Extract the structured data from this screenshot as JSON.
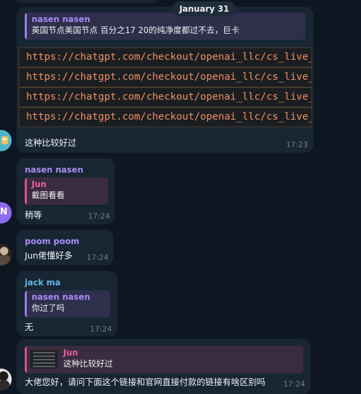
{
  "date_separator": "January 31",
  "messages": [
    {
      "reply_name": "nasen nasen",
      "reply_text": "英国节点美国节点 百分之17 20的纯净度都过不去，巨卡",
      "code_lines": [
        "https://chatgpt.com/checkout/openai_llc/cs_live_",
        "https://chatgpt.com/checkout/openai_llc/cs_live_",
        "https://chatgpt.com/checkout/openai_llc/cs_live_",
        "https://chatgpt.com/checkout/openai_llc/cs_live_"
      ],
      "text": "这种比较好过",
      "time": "17:23"
    },
    {
      "sender": "nasen nasen",
      "reply_name": "Jun",
      "reply_text": "截图看看",
      "text": "稍等",
      "time": "17:24"
    },
    {
      "sender": "poom poom",
      "text": "Jun佬懂好多",
      "time": "17:24"
    },
    {
      "sender": "jack ma",
      "reply_name": "nasen nasen",
      "reply_text": "你过了吗",
      "text": "无",
      "time": "17:24"
    },
    {
      "reply_name": "Jun",
      "reply_text": "这种比较好过",
      "text": "大佬您好，请问下面这个链接和官网直接付款的链接有啥区别吗",
      "time": "17:24"
    }
  ],
  "avatars": [
    {
      "label": ""
    },
    {
      "label": "N"
    },
    {
      "label": ""
    },
    {
      "label": ""
    }
  ],
  "colors": {
    "background": "#0e1621",
    "bubble": "#182533",
    "name_purple": "#a88cf5",
    "name_pink": "#e8609a",
    "name_cyan": "#5fb8e8",
    "code_text": "#f0906a"
  }
}
